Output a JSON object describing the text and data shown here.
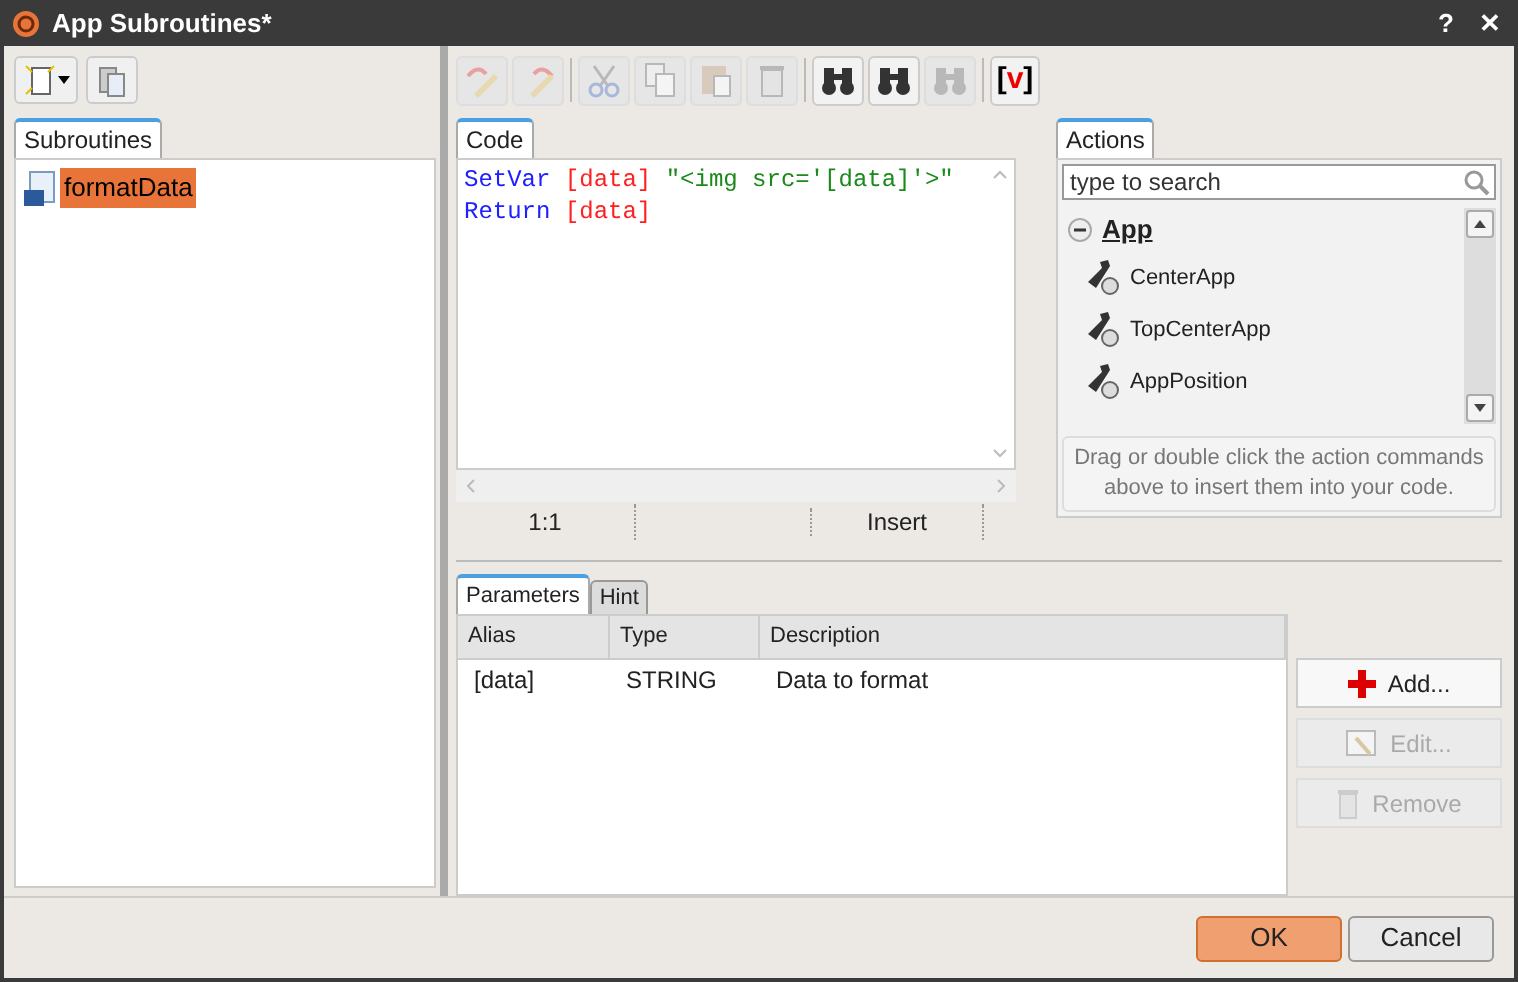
{
  "window": {
    "title": "App Subroutines*",
    "controls": [
      "?",
      "✕"
    ]
  },
  "left_toolbar": [
    {
      "kind": "new"
    },
    {
      "kind": "clipboard"
    }
  ],
  "subroutines": {
    "tab": "Subroutines",
    "items": [
      {
        "label": "formatData",
        "selected": true
      }
    ]
  },
  "editor_toolbar": [
    {
      "kind": "undo",
      "disabled": true
    },
    {
      "kind": "redo",
      "disabled": true
    },
    {
      "kind": "cut",
      "disabled": true
    },
    {
      "kind": "copy",
      "disabled": true
    },
    {
      "kind": "paste",
      "disabled": true
    },
    {
      "kind": "delete",
      "disabled": true
    },
    {
      "kind": "find",
      "disabled": false
    },
    {
      "kind": "find-next",
      "disabled": false
    },
    {
      "kind": "replace",
      "disabled": true
    },
    {
      "kind": "variable",
      "disabled": false,
      "label": "[v]"
    }
  ],
  "code": {
    "tab": "Code",
    "lines": [
      [
        {
          "text": "SetVar",
          "kind": "keyword"
        },
        {
          "text": "[data]",
          "kind": "variable"
        },
        {
          "text": "\"<img src='[data]'>\"",
          "kind": "string"
        }
      ],
      [
        {
          "text": "Return",
          "kind": "keyword"
        },
        {
          "text": "[data]",
          "kind": "variable"
        }
      ]
    ],
    "status": [
      "1:1",
      "Insert"
    ]
  },
  "actions": {
    "tab": "Actions",
    "search_placeholder": "type to search",
    "groups": [
      {
        "label": "App",
        "expanded": true,
        "items": [
          "CenterApp",
          "TopCenterApp",
          "AppPosition"
        ]
      }
    ],
    "hint": "Drag or double click the action commands above to insert them into your code."
  },
  "parameters": {
    "tabs": [
      {
        "label": "Parameters",
        "selected": true
      },
      {
        "label": "Hint",
        "selected": false
      }
    ],
    "columns": [
      "Alias",
      "Type",
      "Description"
    ],
    "rows": [
      [
        "[data]",
        "STRING",
        "Data to format"
      ]
    ],
    "buttons": [
      {
        "kind": "add",
        "label": "Add...",
        "disabled": false
      },
      {
        "kind": "edit",
        "label": "Edit...",
        "disabled": true
      },
      {
        "kind": "remove",
        "label": "Remove",
        "disabled": true
      }
    ]
  },
  "footer": [
    {
      "label": "OK",
      "primary": true
    },
    {
      "label": "Cancel",
      "primary": false
    }
  ]
}
